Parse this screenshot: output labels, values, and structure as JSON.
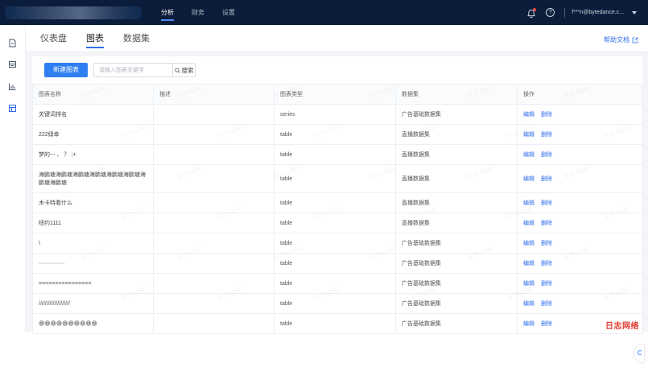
{
  "top_nav": {
    "items": [
      {
        "label": "分析",
        "active": true
      },
      {
        "label": "财务",
        "active": false
      },
      {
        "label": "设置",
        "active": false
      }
    ],
    "user_email": "f***n@bytedance.c..."
  },
  "tabs": [
    {
      "label": "仪表盘",
      "active": false
    },
    {
      "label": "图表",
      "active": true
    },
    {
      "label": "数据集",
      "active": false
    }
  ],
  "help_doc_label": "帮助文档",
  "toolbar": {
    "new_chart_label": "新建图表",
    "search_placeholder": "请输入图表关键字",
    "search_label": "搜索"
  },
  "table": {
    "headers": [
      "图表名称",
      "描述",
      "图表类型",
      "数据集",
      "操作"
    ],
    "edit_label": "编辑",
    "delete_label": "删除",
    "rows": [
      {
        "name": "关键词排名",
        "desc": "",
        "type": "series",
        "dataset": "广告基础数据集",
        "height": 25
      },
      {
        "name": "222绿幸",
        "desc": "",
        "type": "table",
        "dataset": "直播数据集",
        "height": 25
      },
      {
        "name": "梦的~- 、 ？ ;+",
        "desc": "",
        "type": "table",
        "dataset": "直播数据集",
        "height": 25
      },
      {
        "name": "海鹏塘海鹏塘海鹏塘海鹏塘海鹏塘海鹏塘海鹏塘海鹏塘",
        "desc": "",
        "type": "table",
        "dataset": "直播数据集",
        "height": 35
      },
      {
        "name": "木卡特看什么",
        "desc": "",
        "type": "table",
        "dataset": "直播数据集",
        "height": 25
      },
      {
        "name": "纽约1111",
        "desc": "",
        "type": "table",
        "dataset": "直播数据集",
        "height": 25
      },
      {
        "name": "\\",
        "desc": "",
        "type": "table",
        "dataset": "广告基础数据集",
        "height": 25
      },
      {
        "name": "··············",
        "desc": "",
        "type": "table",
        "dataset": "广告基础数据集",
        "height": 25
      },
      {
        "name": "================",
        "desc": "",
        "type": "table",
        "dataset": "广告基础数据集",
        "height": 25
      },
      {
        "name": "////////////////////",
        "desc": "",
        "type": "table",
        "dataset": "广告基础数据集",
        "height": 25
      },
      {
        "name": "😄😄😄😄😄😄😄😄😄😄",
        "desc": "",
        "type": "table",
        "dataset": "广告基础数据集",
        "height": 25
      }
    ]
  },
  "corner_logo": "日志网络",
  "watermark_text": "字节 6868",
  "colors": {
    "nav_bg": "#0b1d3a",
    "accent": "#2f7ff2",
    "link": "#2f6fed",
    "notification_dot": "#f04b4b"
  }
}
